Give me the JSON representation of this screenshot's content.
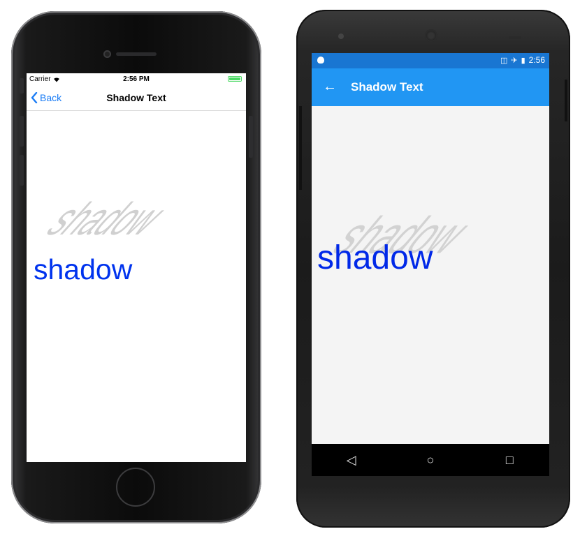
{
  "ios": {
    "status": {
      "carrier": "Carrier",
      "time": "2:56 PM"
    },
    "nav": {
      "back_label": "Back",
      "title": "Shadow Text"
    },
    "content": {
      "main_text": "shadow",
      "shadow_text": "shadow",
      "text_color": "#0033ee",
      "shadow_color": "#c8c8c8"
    }
  },
  "android": {
    "status": {
      "time": "2:56"
    },
    "appbar": {
      "title": "Shadow Text",
      "color": "#2196f3",
      "status_color": "#1976d2"
    },
    "content": {
      "main_text": "shadow",
      "shadow_text": "shadow",
      "text_color": "#0028e8",
      "shadow_color": "#cfcfcf"
    },
    "navbar": {
      "back_icon": "◁",
      "home_icon": "○",
      "recents_icon": "□"
    }
  }
}
